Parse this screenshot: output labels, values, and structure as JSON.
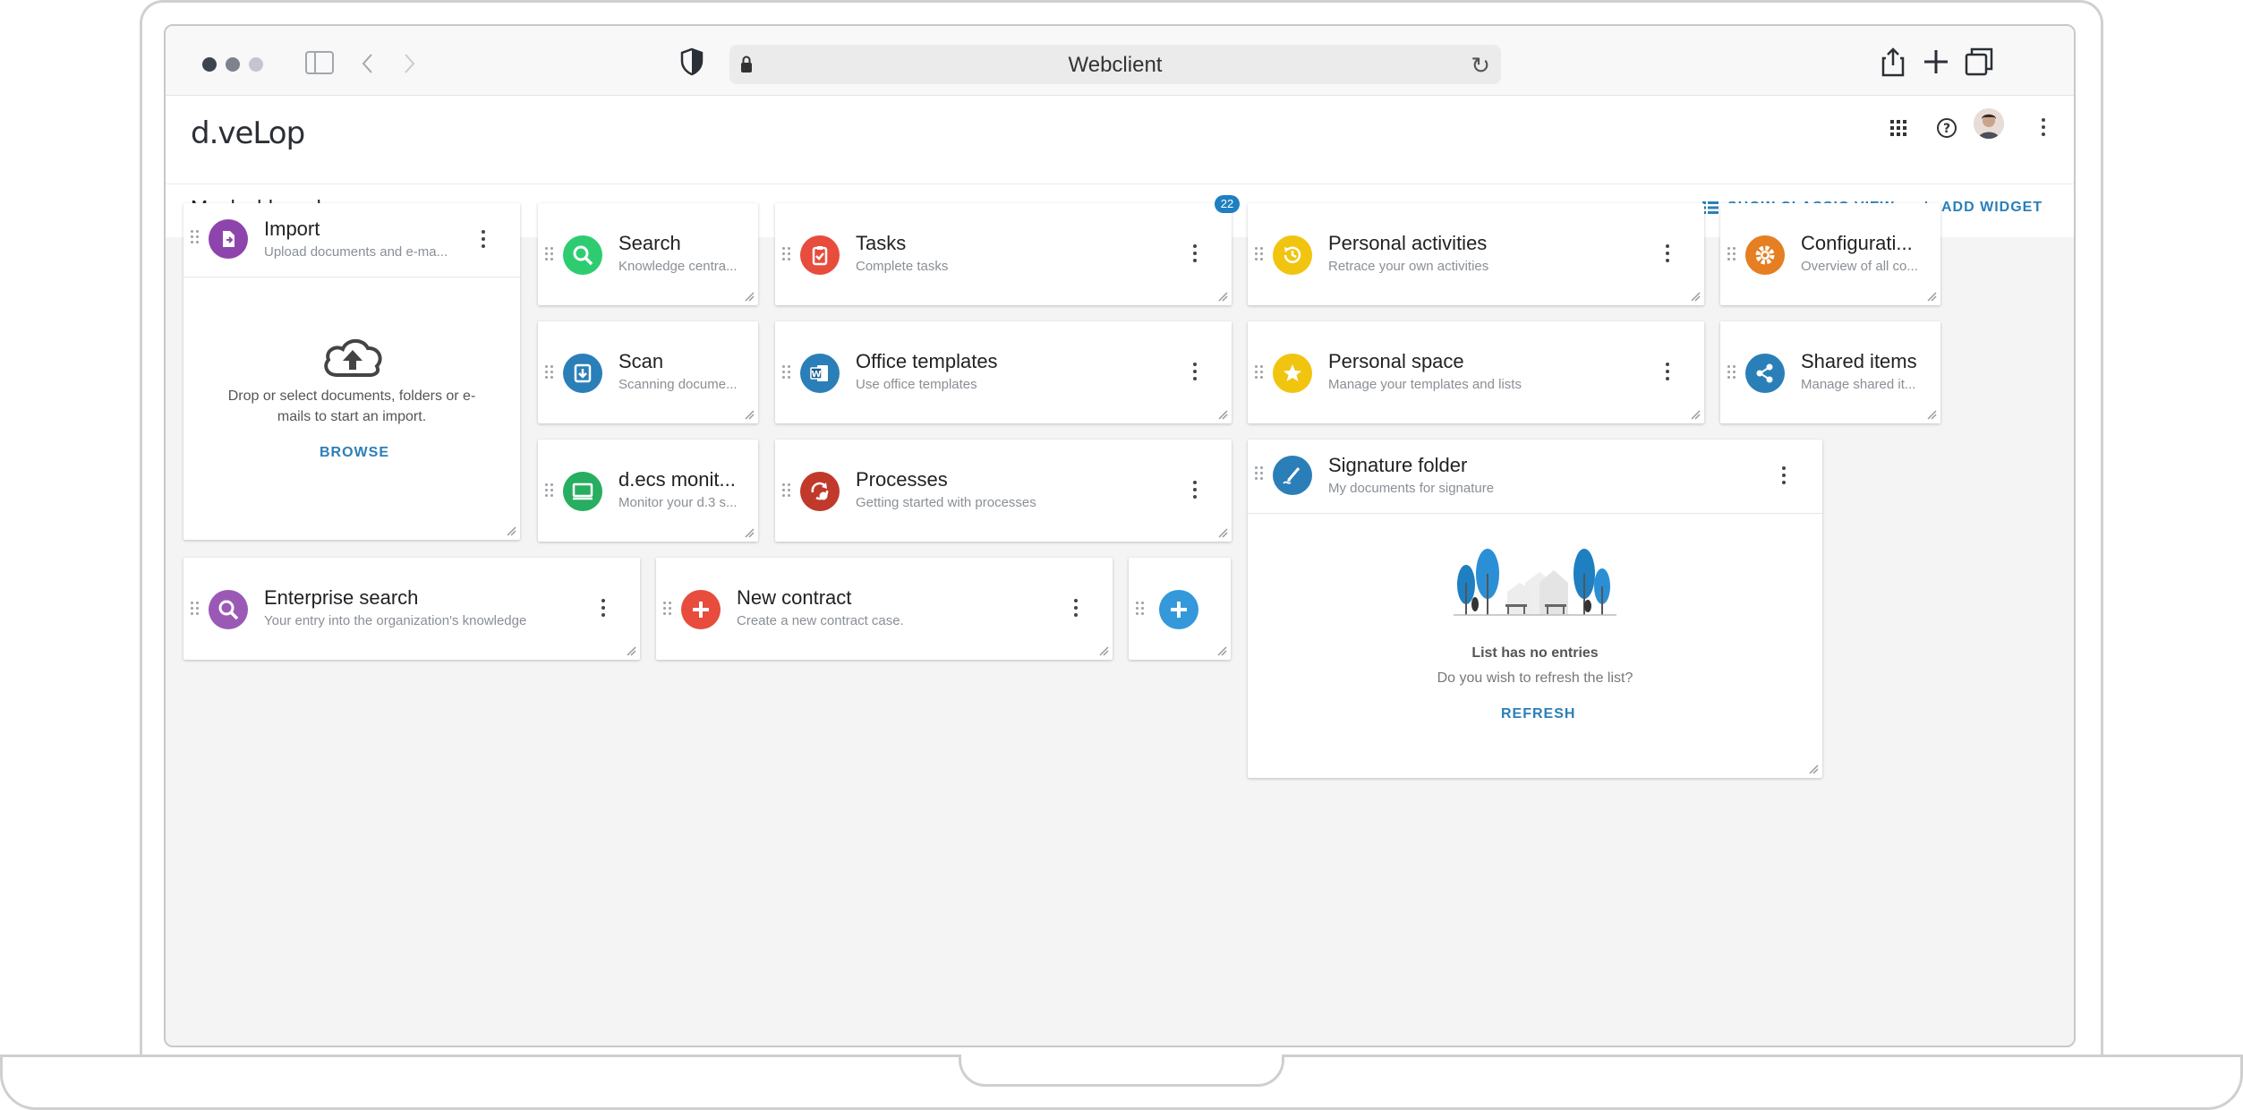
{
  "browser": {
    "url_label": "Webclient"
  },
  "app": {
    "logo": "d.veLop",
    "page_title": "My dashboard",
    "actions": {
      "classic_view": "SHOW CLASSIC VIEW",
      "add_widget": "ADD WIDGET"
    }
  },
  "widgets": {
    "import": {
      "title": "Import",
      "subtitle": "Upload documents and e-ma...",
      "drop_text": "Drop or select documents, folders or e-mails to start an import.",
      "browse": "BROWSE",
      "color": "#8e44ad"
    },
    "search": {
      "title": "Search",
      "subtitle": "Knowledge centra...",
      "color": "#2ecc71"
    },
    "tasks": {
      "title": "Tasks",
      "subtitle": "Complete tasks",
      "badge": "22",
      "color": "#e74c3c"
    },
    "personal_activities": {
      "title": "Personal activities",
      "subtitle": "Retrace your own activities",
      "color": "#f1c40f"
    },
    "configuration": {
      "title": "Configurati...",
      "subtitle": "Overview of all co...",
      "color": "#e67e22"
    },
    "scan": {
      "title": "Scan",
      "subtitle": "Scanning docume...",
      "color": "#2b7fb8"
    },
    "office_templates": {
      "title": "Office templates",
      "subtitle": "Use office templates",
      "color": "#2b7fb8"
    },
    "personal_space": {
      "title": "Personal space",
      "subtitle": "Manage your templates and lists",
      "color": "#f1c40f"
    },
    "shared_items": {
      "title": "Shared items",
      "subtitle": "Manage shared it...",
      "color": "#2b7fb8"
    },
    "decs_monitor": {
      "title": "d.ecs monit...",
      "subtitle": "Monitor your d.3 s...",
      "color": "#27ae60"
    },
    "processes": {
      "title": "Processes",
      "subtitle": "Getting started with processes",
      "color": "#c0392b"
    },
    "signature_folder": {
      "title": "Signature folder",
      "subtitle": "My documents for signature",
      "empty_title": "List has no entries",
      "empty_text": "Do you wish to refresh the list?",
      "refresh": "REFRESH",
      "color": "#2b7fb8"
    },
    "enterprise_search": {
      "title": "Enterprise search",
      "subtitle": "Your entry into the organization's knowledge",
      "color": "#9b59b6"
    },
    "new_contract": {
      "title": "New contract",
      "subtitle": "Create a new contract case.",
      "color": "#e74c3c"
    },
    "add_tile": {
      "color": "#3498db"
    }
  }
}
